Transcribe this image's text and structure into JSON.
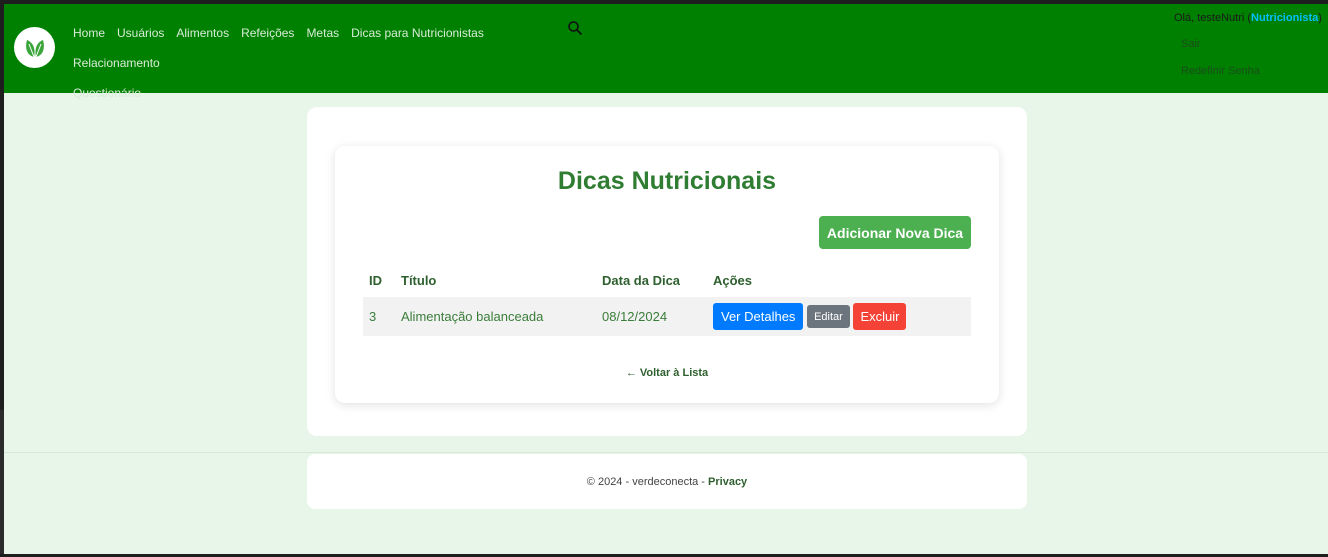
{
  "colors": {
    "navbar": "#008000",
    "page_background": "#e8f5e9",
    "title": "#2e7d32",
    "add_button": "#4caf50",
    "view_button": "#007bff",
    "edit_button": "#6c757d",
    "delete_button": "#f44336",
    "role_highlight": "#00bfff"
  },
  "nav": {
    "logo_icon": "leaf-icon",
    "links": [
      "Home",
      "Usuários",
      "Alimentos",
      "Refeições",
      "Metas",
      "Dicas para Nutricionistas",
      "Relacionamento",
      "Questionário"
    ],
    "search_icon": "search-icon"
  },
  "user": {
    "greeting": "Olá, testeNutri (",
    "role": "Nutricionista",
    "greeting_end": ")",
    "logout": "Sair",
    "reset_password": "Redefinir Senha"
  },
  "main": {
    "title": "Dicas Nutricionais",
    "add_button": "Adicionar Nova Dica",
    "table": {
      "headers": [
        "ID",
        "Título",
        "Data da Dica",
        "Ações"
      ],
      "rows": [
        {
          "id": "3",
          "titulo": "Alimentação balanceada",
          "data": "08/12/2024",
          "actions": [
            "Ver Detalhes",
            "Editar",
            "Excluir"
          ]
        }
      ]
    },
    "back_link": "← Voltar à Lista"
  },
  "footer": {
    "text": "© 2024 - verdeconecta - ",
    "privacy": "Privacy"
  }
}
